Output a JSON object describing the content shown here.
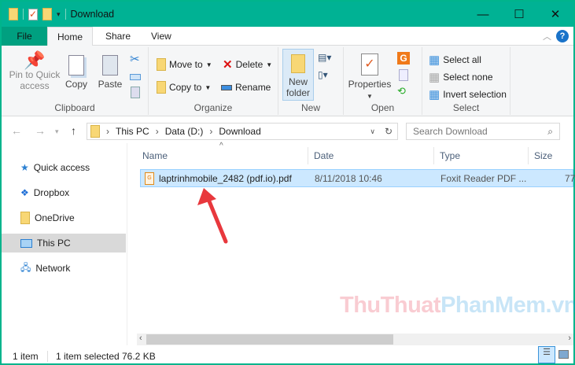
{
  "window": {
    "title": "Download",
    "buttons": [
      "—",
      "☐",
      "✕"
    ]
  },
  "tabs": {
    "file": "File",
    "home": "Home",
    "share": "Share",
    "view": "View",
    "help": "?"
  },
  "ribbon": {
    "clipboard": {
      "label": "Clipboard",
      "pin": "Pin to Quick access",
      "copy": "Copy",
      "paste": "Paste"
    },
    "organize": {
      "label": "Organize",
      "move_to": "Move to",
      "copy_to": "Copy to",
      "delete": "Delete",
      "rename": "Rename"
    },
    "new": {
      "label": "New",
      "new_folder": "New folder"
    },
    "open": {
      "label": "Open",
      "properties": "Properties"
    },
    "select": {
      "label": "Select",
      "select_all": "Select all",
      "select_none": "Select none",
      "invert": "Invert selection"
    }
  },
  "address": {
    "crumbs": [
      "This PC",
      "Data (D:)",
      "Download"
    ],
    "search_placeholder": "Search Download"
  },
  "sidebar": {
    "items": [
      {
        "label": "Quick access"
      },
      {
        "label": "Dropbox"
      },
      {
        "label": "OneDrive"
      },
      {
        "label": "This PC"
      },
      {
        "label": "Network"
      }
    ]
  },
  "columns": {
    "name": "Name",
    "date": "Date",
    "type": "Type",
    "size": "Size"
  },
  "files": [
    {
      "name": "laptrinhmobile_2482 (pdf.io).pdf",
      "date": "8/11/2018 10:46",
      "type": "Foxit Reader PDF ...",
      "size": "77"
    }
  ],
  "status": {
    "count": "1 item",
    "selected": "1 item selected",
    "size": "76.2 KB"
  },
  "watermark": {
    "part1": "ThuThuat",
    "part2": "PhanMem.vn"
  },
  "colors": {
    "titlebar": "#00b294",
    "selection": "#cce8ff",
    "arrow": "#e8383d"
  }
}
